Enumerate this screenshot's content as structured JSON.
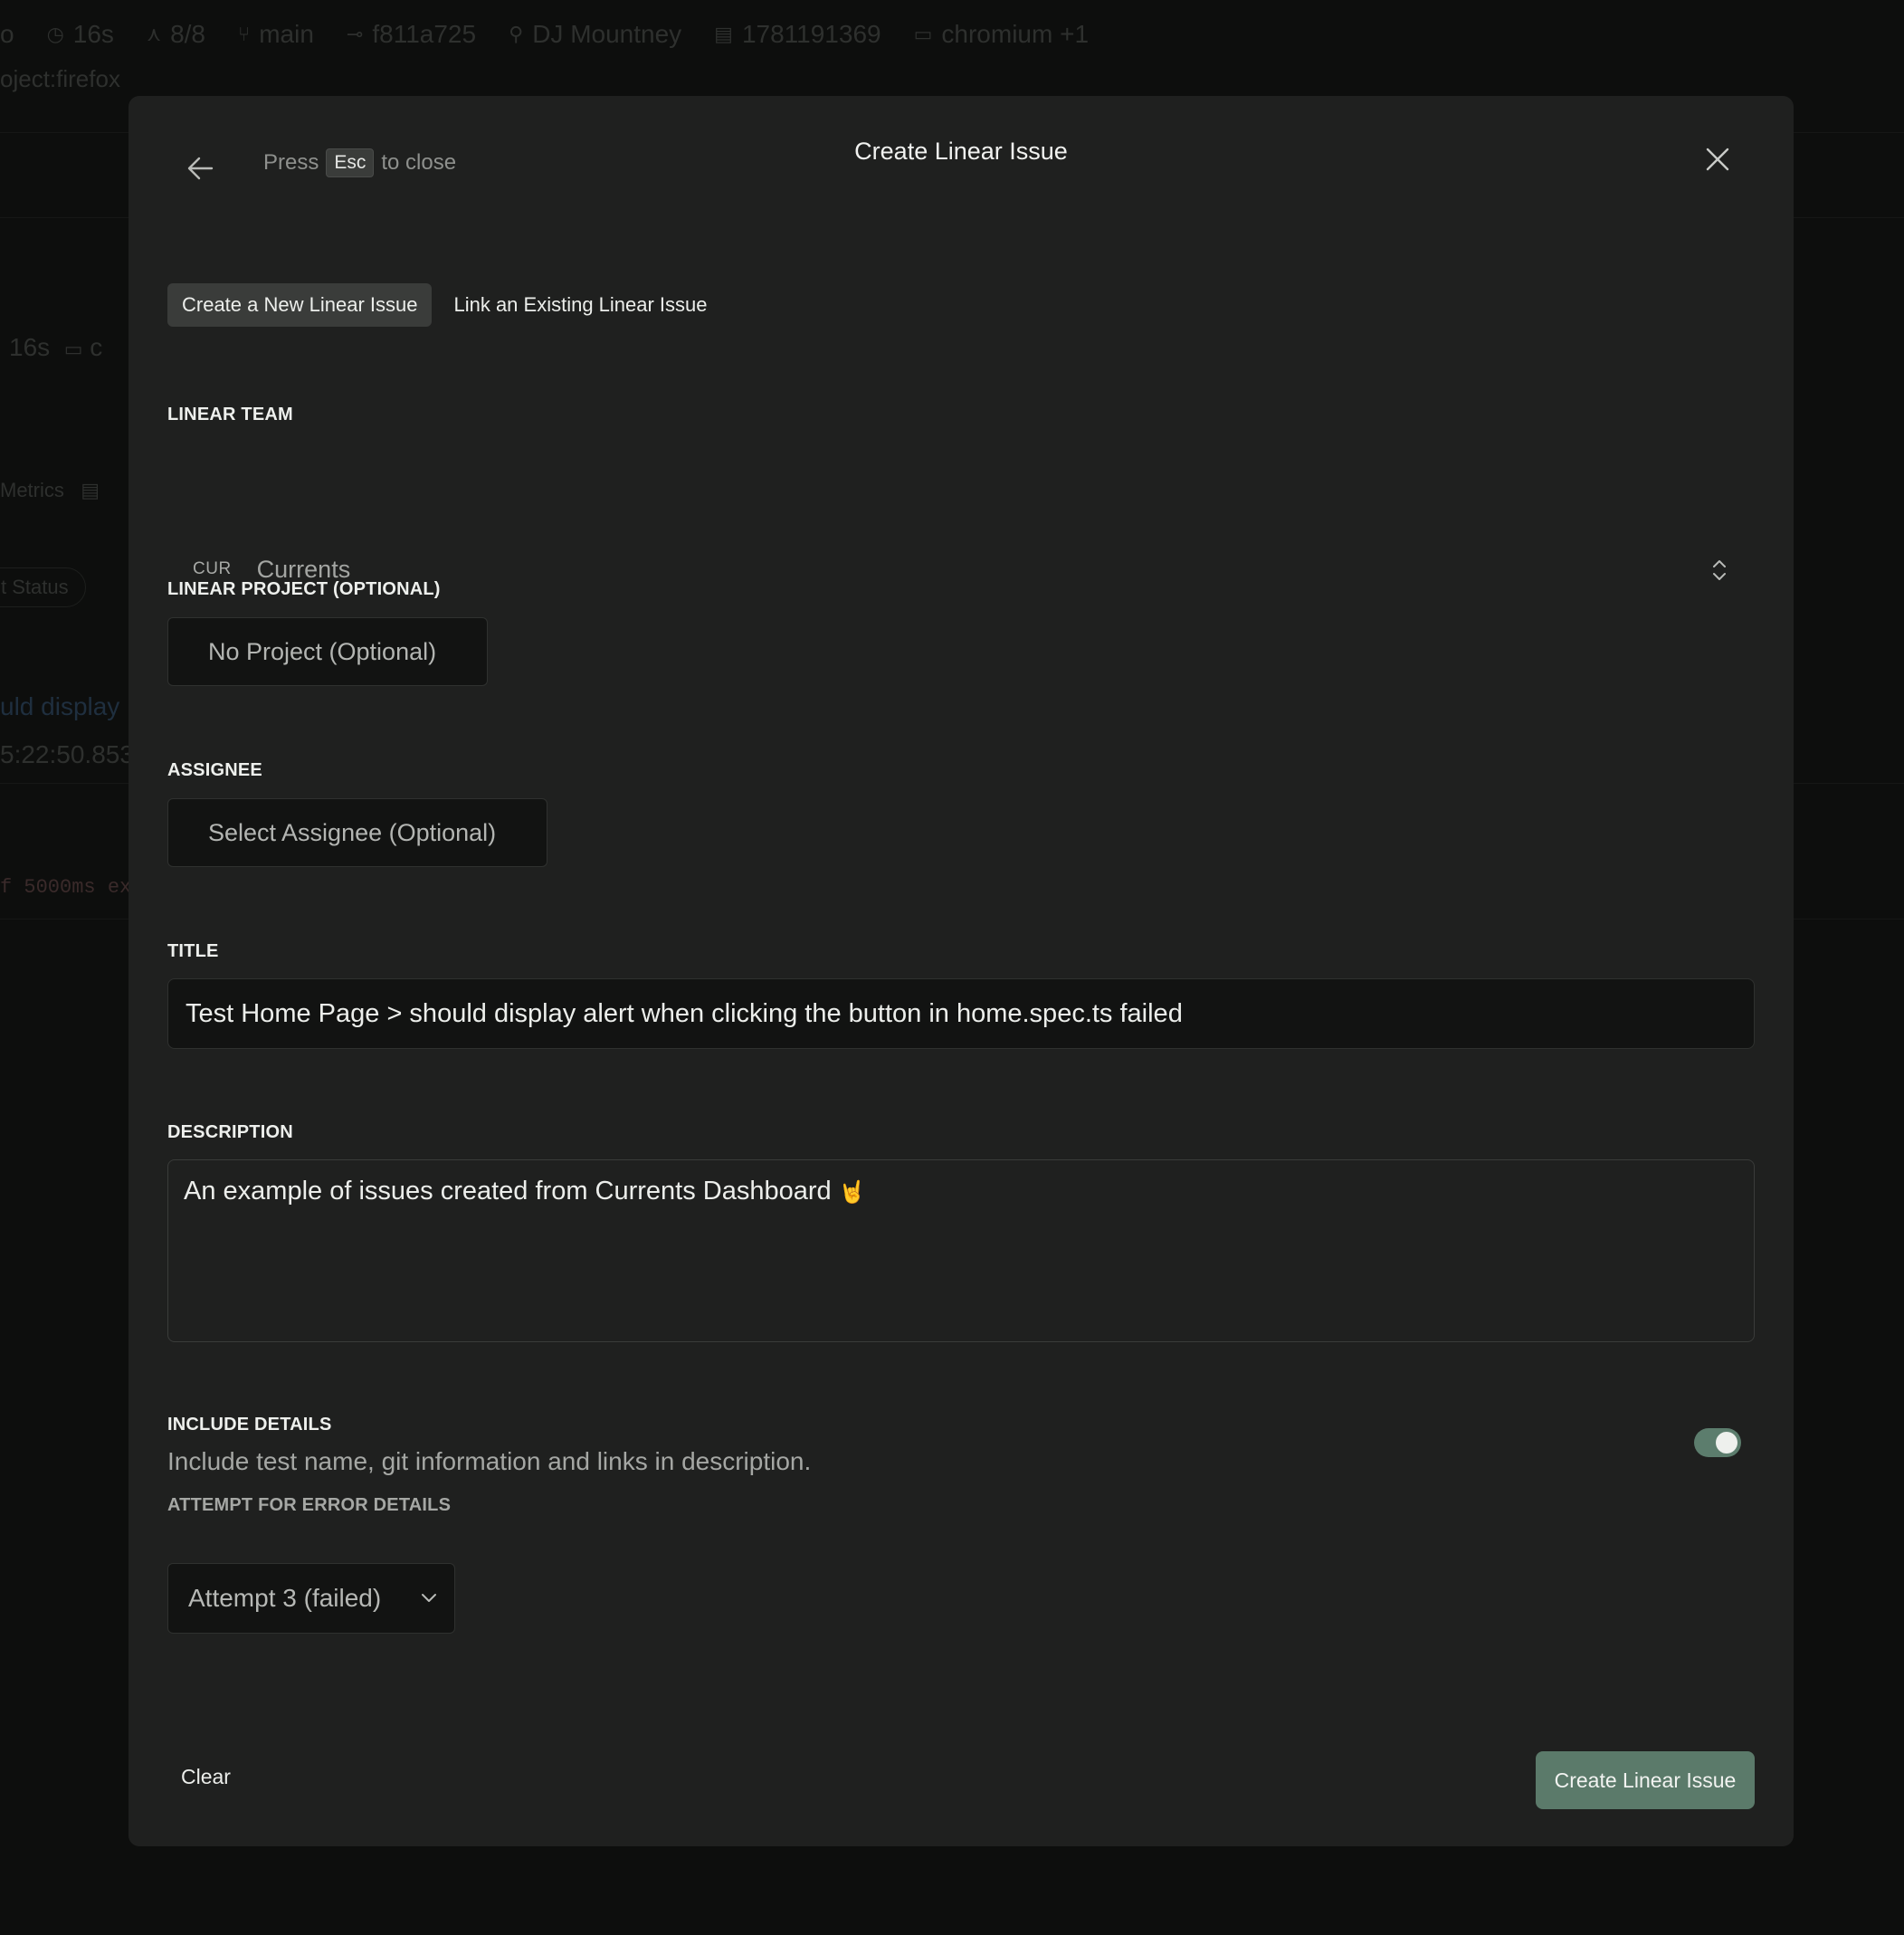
{
  "background": {
    "meta": {
      "status_fragment": "o",
      "duration": "16s",
      "tests": "8/8",
      "branch": "main",
      "commit": "f811a725",
      "author": "DJ Mountney",
      "build": "1781191369",
      "browsers": "chromium +1"
    },
    "filter": "oject:firefox",
    "duration_row": "16s",
    "duration_suffix": "c",
    "metrics_tab": "Metrics",
    "status_chip": "t Status",
    "test_title": "uld display",
    "timestamp": "5:22:50.853",
    "error_snippet": "f 5000ms exc"
  },
  "modal": {
    "esc_hint": {
      "prefix": "Press",
      "key": "Esc",
      "suffix": "to close"
    },
    "title": "Create Linear Issue",
    "tabs": [
      {
        "label": "Create a New Linear Issue",
        "active": true
      },
      {
        "label": "Link an Existing Linear Issue",
        "active": false
      }
    ],
    "team": {
      "label": "LINEAR TEAM",
      "key": "CUR",
      "name": "Currents"
    },
    "project": {
      "label": "LINEAR PROJECT (OPTIONAL)",
      "value": "No Project (Optional)"
    },
    "assignee": {
      "label": "ASSIGNEE",
      "value": "Select Assignee (Optional)"
    },
    "title_field": {
      "label": "TITLE",
      "value": "Test Home Page > should display alert when clicking the button in home.spec.ts failed"
    },
    "description": {
      "label": "DESCRIPTION",
      "value": "An example of issues created from Currents Dashboard"
    },
    "include_details": {
      "label": "INCLUDE DETAILS",
      "description": "Include test name, git information and links in description.",
      "enabled": true
    },
    "attempt": {
      "label": "ATTEMPT FOR ERROR DETAILS",
      "selected": "Attempt 3 (failed)"
    },
    "clear_label": "Clear",
    "submit_label": "Create Linear Issue"
  },
  "colors": {
    "modal_bg": "#1f201f",
    "input_bg": "#121312",
    "accent_green": "#5b7a6a",
    "toggle_on": "#5c7d6d"
  },
  "icons": [
    "arrow-left-icon",
    "close-icon",
    "chevron-up-down-icon",
    "chevron-down-icon",
    "rock-hand-emoji-icon"
  ]
}
